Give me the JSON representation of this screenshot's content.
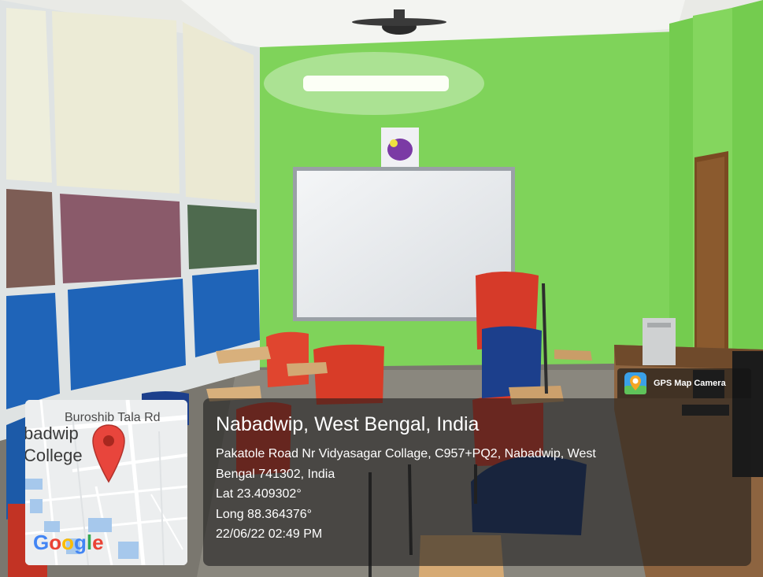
{
  "overlay": {
    "app_name": "GPS Map Camera",
    "location_title": "Nabadwip, West Bengal, India",
    "address_line_1": "Pakatole Road Nr Vidyasagar Collage, C957+PQ2, Nabadwip, West",
    "address_line_2": "Bengal 741302, India",
    "latitude": "Lat 23.409302°",
    "longitude": "Long 88.364376°",
    "datetime": "22/06/22 02:49 PM"
  },
  "map": {
    "road_label": "Buroshib Tala Rd",
    "place_line_1": "badwip",
    "place_line_2": "College",
    "provider_logo": "Google"
  },
  "colors": {
    "wall": "#7fd35a",
    "blue_panel": "#1f64b8",
    "chair_red": "#e0452f",
    "chair_blue": "#1c3f8c",
    "pin_red": "#e8453c"
  },
  "icons": {
    "brand": "gps-map-camera-icon",
    "pin": "map-pin-icon"
  }
}
